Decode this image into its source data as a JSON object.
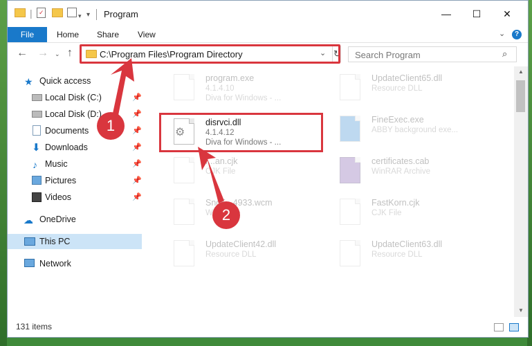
{
  "window": {
    "title": "Program",
    "controls": {
      "minimize": "—",
      "maximize": "☐",
      "close": "✕"
    }
  },
  "ribbon": {
    "tabs": [
      "File",
      "Home",
      "Share",
      "View"
    ],
    "expand_icon": "chevron-down-icon",
    "help_icon": "?"
  },
  "address": {
    "path": "C:\\Program Files\\Program Directory",
    "search_placeholder": "Search Program"
  },
  "nav": {
    "quick_access": "Quick access",
    "items": [
      "Local Disk (C:)",
      "Local Disk (D:)",
      "Documents",
      "Downloads",
      "Music",
      "Pictures",
      "Videos"
    ],
    "onedrive": "OneDrive",
    "this_pc": "This PC",
    "network": "Network"
  },
  "files": {
    "program_exe": {
      "name": "program.exe",
      "line1": "4.1.4.10",
      "line2": "Diva for Windows - ..."
    },
    "updateclient65": {
      "name": "UpdateClient65.dll",
      "line1": "Resource DLL"
    },
    "disrvci": {
      "name": "disrvci.dll",
      "line1": "4.1.4.12",
      "line2": "Diva for Windows - ..."
    },
    "fineexec": {
      "name": "FineExec.exe",
      "line1": "ABBY background exe..."
    },
    "cjk_file": {
      "name": "f...an.cjk",
      "line1": "CJK File"
    },
    "certificates": {
      "name": "certificates.cab",
      "line1": "WinRAR Archive"
    },
    "wcm_file": {
      "name": "Snd5...4933.wcm",
      "line1": "WCM File"
    },
    "fastkorn": {
      "name": "FastKorn.cjk",
      "line1": "CJK File"
    },
    "updateclient42": {
      "name": "UpdateClient42.dll",
      "line1": "Resource DLL"
    },
    "updateclient63": {
      "name": "UpdateClient63.dll",
      "line1": "Resource DLL"
    }
  },
  "status": {
    "item_count": "131 items"
  },
  "annotations": {
    "step1": "1",
    "step2": "2"
  },
  "colors": {
    "accent": "#1979ca",
    "highlight": "#d9363e",
    "selection": "#cce4f7"
  }
}
